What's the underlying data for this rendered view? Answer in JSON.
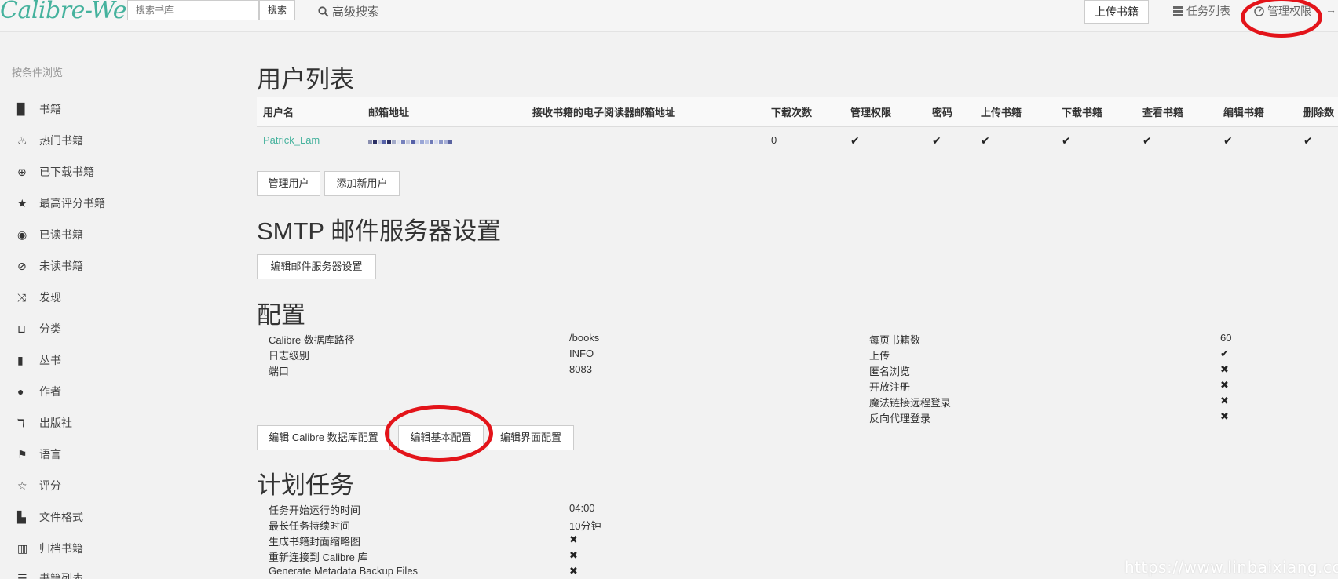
{
  "header": {
    "logo": "Calibre-Web",
    "search_placeholder": "搜索书库",
    "search_button": "搜索",
    "advanced_search": "高级搜索",
    "upload": "上传书籍",
    "tasks": "任务列表",
    "admin": "管理权限"
  },
  "sidebar": {
    "title": "按条件浏览",
    "items": [
      {
        "label": "书籍",
        "icon": "book-icon"
      },
      {
        "label": "热门书籍",
        "icon": "fire-icon"
      },
      {
        "label": "已下载书籍",
        "icon": "download-icon"
      },
      {
        "label": "最高评分书籍",
        "icon": "star-icon"
      },
      {
        "label": "已读书籍",
        "icon": "eye-icon"
      },
      {
        "label": "未读书籍",
        "icon": "eye-slash-icon"
      },
      {
        "label": "发现",
        "icon": "shuffle-icon"
      },
      {
        "label": "分类",
        "icon": "inbox-icon"
      },
      {
        "label": "丛书",
        "icon": "bookmark-icon"
      },
      {
        "label": "作者",
        "icon": "user-icon"
      },
      {
        "label": "出版社",
        "icon": "text-size-icon"
      },
      {
        "label": "语言",
        "icon": "flag-icon"
      },
      {
        "label": "评分",
        "icon": "star-empty-icon"
      },
      {
        "label": "文件格式",
        "icon": "file-icon"
      },
      {
        "label": "归档书籍",
        "icon": "trash-icon"
      },
      {
        "label": "书籍列表",
        "icon": "list-icon"
      }
    ]
  },
  "users": {
    "heading": "用户列表",
    "columns": [
      "用户名",
      "邮箱地址",
      "接收书籍的电子阅读器邮箱地址",
      "下载次数",
      "管理权限",
      "密码",
      "上传书籍",
      "下载书籍",
      "查看书籍",
      "编辑书籍",
      "删除数"
    ],
    "rows": [
      {
        "username": "Patrick_Lam",
        "downloads": "0",
        "check": "✔"
      }
    ],
    "manage_button": "管理用户",
    "add_button": "添加新用户"
  },
  "smtp": {
    "heading": "SMTP 邮件服务器设置",
    "edit_button": "编辑邮件服务器设置"
  },
  "config": {
    "heading": "配置",
    "left": [
      {
        "label": "Calibre 数据库路径",
        "value": "/books"
      },
      {
        "label": "日志级别",
        "value": "INFO"
      },
      {
        "label": "端口",
        "value": "8083"
      }
    ],
    "right": [
      {
        "label": "每页书籍数",
        "value": "60"
      },
      {
        "label": "上传",
        "value": "✔"
      },
      {
        "label": "匿名浏览",
        "value": "✖"
      },
      {
        "label": "开放注册",
        "value": "✖"
      },
      {
        "label": "魔法链接远程登录",
        "value": "✖"
      },
      {
        "label": "反向代理登录",
        "value": "✖"
      }
    ],
    "buttons": [
      "编辑 Calibre 数据库配置",
      "编辑基本配置",
      "编辑界面配置"
    ]
  },
  "scheduled": {
    "heading": "计划任务",
    "rows": [
      {
        "label": "任务开始运行的时间",
        "value": "04:00"
      },
      {
        "label": "最长任务持续时间",
        "value": "10分钟"
      },
      {
        "label": "生成书籍封面缩略图",
        "value": "✖"
      },
      {
        "label": "重新连接到 Calibre 库",
        "value": "✖"
      },
      {
        "label": "Generate Metadata Backup Files",
        "value": "✖"
      }
    ]
  },
  "watermark": "https://www.linbaixiang.com",
  "colors": {
    "accent": "#45b29d",
    "annotation": "#e3141a"
  }
}
